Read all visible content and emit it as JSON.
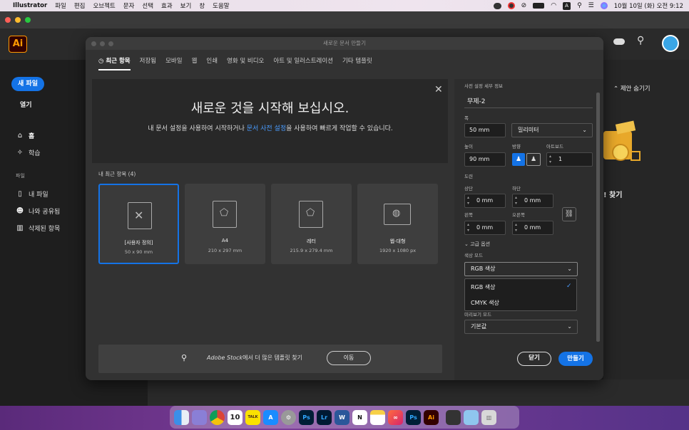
{
  "menubar": {
    "apple": "",
    "app_name": "Illustrator",
    "items": [
      "파일",
      "편집",
      "오브젝트",
      "문자",
      "선택",
      "효과",
      "보기",
      "창",
      "도움말"
    ],
    "clock": "10월 10일 (화) 오전 9:12",
    "status_icons": [
      "creative-cloud-icon",
      "adobe-icon",
      "screen-mirror-icon",
      "battery-icon",
      "wifi-icon",
      "input-source-icon",
      "spotlight-icon",
      "control-center-icon",
      "siri-icon"
    ],
    "input_source": "A"
  },
  "app": {
    "logo": "Ai",
    "new_file": "새 파일",
    "open": "열기",
    "nav": [
      {
        "label": "홈",
        "icon": "home-icon"
      },
      {
        "label": "학습",
        "icon": "lightbulb-icon"
      }
    ],
    "files_section": "파일",
    "files_nav": [
      {
        "label": "내 파일",
        "icon": "file-icon"
      },
      {
        "label": "나와 공유됨",
        "icon": "users-icon"
      },
      {
        "label": "삭제된 항목",
        "icon": "trash-icon"
      }
    ],
    "hide_suggestions": "제안 숨기기",
    "find_partial": "! 찾기"
  },
  "dialog": {
    "title": "새로운 문서 만들기",
    "tabs": [
      "최근 항목",
      "저장됨",
      "모바일",
      "웹",
      "인쇄",
      "영화 및 비디오",
      "아트 및 일러스트레이션",
      "기타 템플릿"
    ],
    "banner": {
      "heading": "새로운 것을 시작해 보십시오.",
      "sub_1": "내 문서 설정을 사용하여 시작하거나 ",
      "sub_link": "문서 사전 설정",
      "sub_2": "을 사용하여 빠르게 작업할 수 있습니다."
    },
    "recent_label": "내 최근 항목 (4)",
    "cards": [
      {
        "name": "[사용자 정의]",
        "size": "50 x 90 mm",
        "selected": true
      },
      {
        "name": "A4",
        "size": "210 x 297 mm",
        "selected": false
      },
      {
        "name": "레터",
        "size": "215.9 x 279.4 mm",
        "selected": false
      },
      {
        "name": "웹-대형",
        "size": "1920 x 1080 px",
        "selected": false
      }
    ],
    "stock": {
      "brand": "Adobe Stock",
      "text": "에서 더 많은 템플릿 찾기",
      "button": "이동"
    },
    "presets": {
      "header": "사전 설정 세부 정보",
      "doc_name": "무제-2",
      "width_label": "폭",
      "width": "50 mm",
      "unit": "밀리미터",
      "height_label": "높이",
      "height": "90 mm",
      "orientation_label": "방향",
      "artboards_label": "아트보드",
      "artboards": "1",
      "bleed_label": "도련",
      "top_label": "상단",
      "bottom_label": "하단",
      "left_label": "왼쪽",
      "right_label": "오른쪽",
      "bleed_top": "0 mm",
      "bleed_bottom": "0 mm",
      "bleed_left": "0 mm",
      "bleed_right": "0 mm",
      "advanced": "고급 옵션",
      "color_mode_label": "색상 모드",
      "color_mode": "RGB 색상",
      "color_options": [
        "RGB 색상",
        "CMYK 색상"
      ],
      "preview_label": "미리보기 모드",
      "preview_mode": "기본값"
    },
    "close_button": "닫기",
    "create_button": "만들기"
  },
  "dock": {
    "apps": [
      "finder-icon",
      "launchpad-icon",
      "chrome-icon",
      "calendar-icon",
      "kakaotalk-icon",
      "app-store-icon",
      "system-settings-icon",
      "photoshop-icon",
      "lightroom-icon",
      "word-icon",
      "notion-icon",
      "notes-icon",
      "creative-cloud-icon",
      "photoshop-icon",
      "illustrator-icon",
      "screenshot-icon",
      "preview-icon",
      "trash-icon"
    ],
    "calendar_day": "10",
    "kakao_label": "TALK"
  },
  "colors": {
    "accent": "#1473e6",
    "ai_orange": "#ff9a00"
  }
}
